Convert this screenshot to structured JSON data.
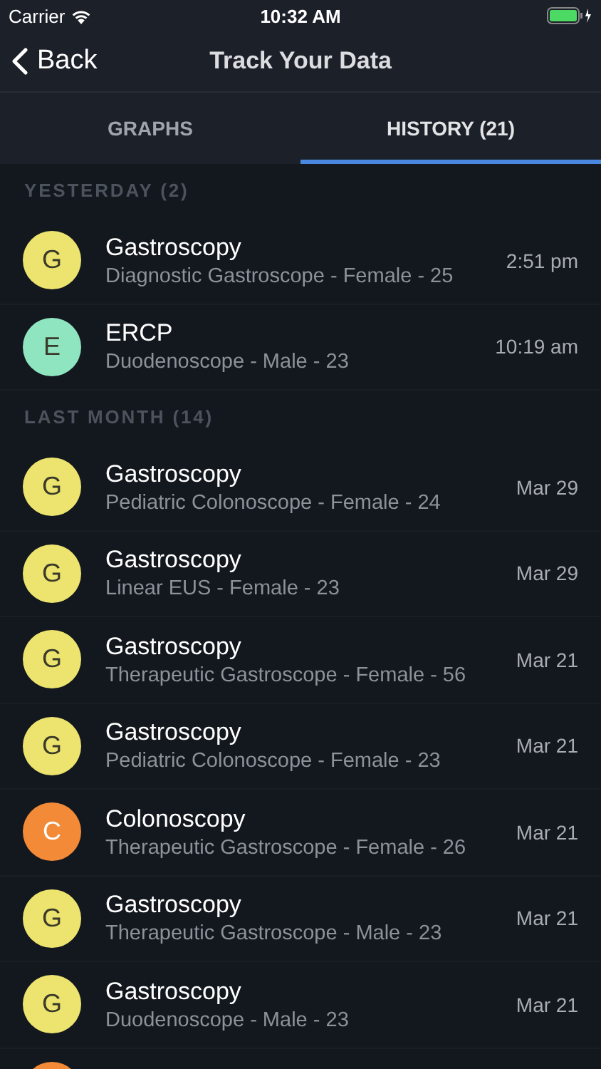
{
  "status_bar": {
    "carrier": "Carrier",
    "time": "10:32 AM"
  },
  "nav": {
    "back": "Back",
    "title": "Track Your Data"
  },
  "tabs": [
    {
      "label": "GRAPHS",
      "selected": false
    },
    {
      "label": "HISTORY (21)",
      "selected": true
    }
  ],
  "sections": [
    {
      "header": "YESTERDAY (2)",
      "items": [
        {
          "initial": "G",
          "color": "#ece46e",
          "title": "Gastroscopy",
          "subtitle": "Diagnostic Gastroscope - Female - 25",
          "time": "2:51 pm"
        },
        {
          "initial": "E",
          "color": "#8fe5c0",
          "title": "ERCP",
          "subtitle": "Duodenoscope - Male - 23",
          "time": "10:19 am"
        }
      ]
    },
    {
      "header": "LAST MONTH (14)",
      "items": [
        {
          "initial": "G",
          "color": "#ece46e",
          "title": "Gastroscopy",
          "subtitle": "Pediatric Colonoscope - Female - 24",
          "time": "Mar 29"
        },
        {
          "initial": "G",
          "color": "#ece46e",
          "title": "Gastroscopy",
          "subtitle": "Linear EUS - Female - 23",
          "time": "Mar 29"
        },
        {
          "initial": "G",
          "color": "#ece46e",
          "title": "Gastroscopy",
          "subtitle": "Therapeutic Gastroscope - Female - 56",
          "time": "Mar 21"
        },
        {
          "initial": "G",
          "color": "#ece46e",
          "title": "Gastroscopy",
          "subtitle": "Pediatric Colonoscope - Female - 23",
          "time": "Mar 21"
        },
        {
          "initial": "C",
          "color": "#f28a38",
          "title": "Colonoscopy",
          "subtitle": "Therapeutic Gastroscope - Female - 26",
          "time": "Mar 21"
        },
        {
          "initial": "G",
          "color": "#ece46e",
          "title": "Gastroscopy",
          "subtitle": "Therapeutic Gastroscope - Male - 23",
          "time": "Mar 21"
        },
        {
          "initial": "G",
          "color": "#ece46e",
          "title": "Gastroscopy",
          "subtitle": "Duodenoscope - Male - 23",
          "time": "Mar 21"
        },
        {
          "color": "#f28a38"
        }
      ]
    }
  ]
}
